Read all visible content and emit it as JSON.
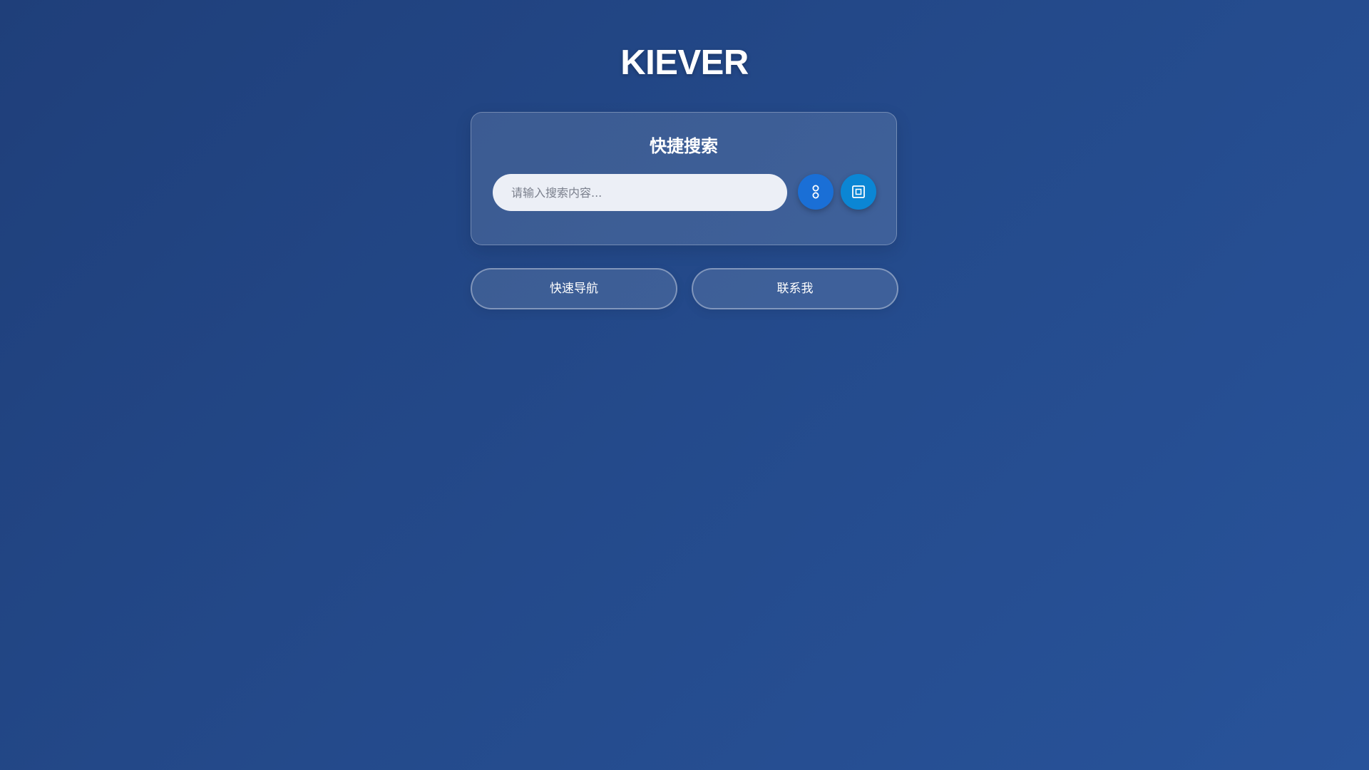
{
  "header": {
    "title": "KIEVER"
  },
  "search": {
    "title": "快捷搜索",
    "placeholder": "请输入搜索内容...",
    "value": "",
    "buttons": [
      {
        "icon": "link-nodes-icon",
        "color": "#1a6fd6"
      },
      {
        "icon": "square-frame-icon",
        "color": "#0b86d4"
      }
    ]
  },
  "actions": {
    "nav_label": "快速导航",
    "contact_label": "联系我"
  },
  "colors": {
    "background_start": "#1f3f7a",
    "background_end": "#28539a",
    "accent_blue": "#1a6fd6",
    "accent_cyan": "#0b86d4"
  }
}
